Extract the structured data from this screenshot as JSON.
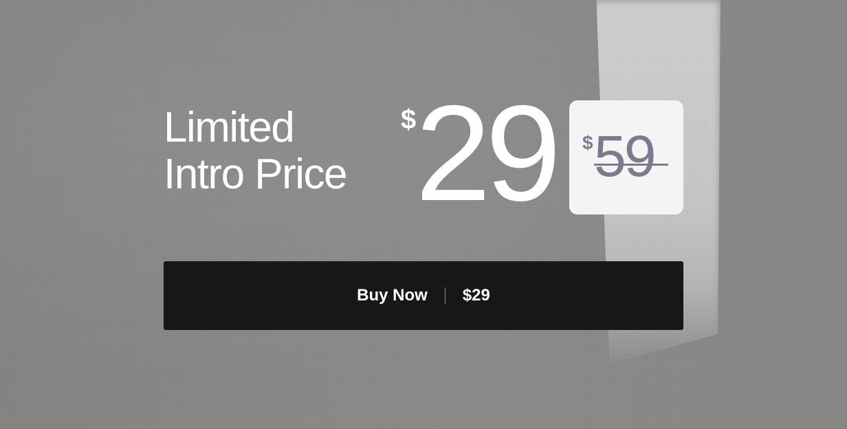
{
  "headline": {
    "line1": "Limited",
    "line2": "Intro Price"
  },
  "current_price": {
    "currency": "$",
    "amount": "29"
  },
  "original_price": {
    "currency": "$",
    "amount": "59"
  },
  "buy_button": {
    "label": "Buy Now",
    "price": "$29"
  },
  "colors": {
    "background": "#8a8887",
    "card": "#f4f4f5",
    "old_price": "#7c7a8d",
    "button": "#171717",
    "text": "#ffffff"
  }
}
